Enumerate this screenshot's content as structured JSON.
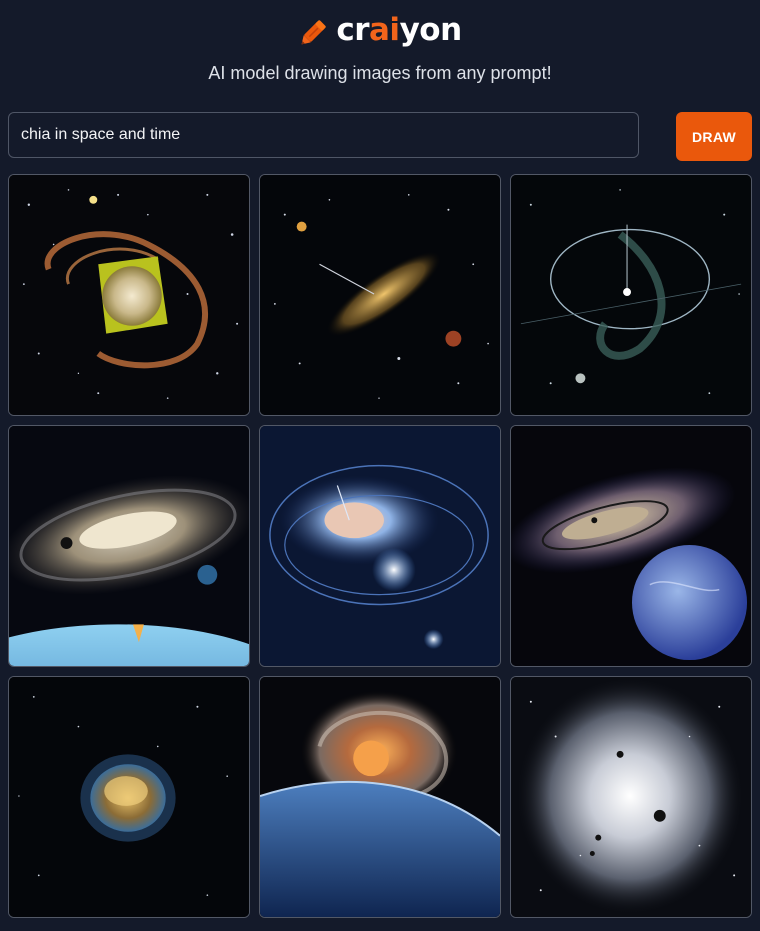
{
  "header": {
    "logo_part1": "cr",
    "logo_accent": "ai",
    "logo_part2": "yon",
    "logo_icon": "pencil-icon",
    "tagline": "AI model drawing images from any prompt!"
  },
  "prompt": {
    "value": "chia in space and time"
  },
  "draw_button": {
    "label": "DRAW"
  },
  "colors": {
    "background": "#141a2a",
    "accent": "#ea580c",
    "logo_accent": "#f2641b",
    "tile_border": "#525866"
  },
  "images": [
    {
      "name": "chia in space and time result 1"
    },
    {
      "name": "chia in space and time result 2"
    },
    {
      "name": "chia in space and time result 3"
    },
    {
      "name": "chia in space and time result 4"
    },
    {
      "name": "chia in space and time result 5"
    },
    {
      "name": "chia in space and time result 6"
    },
    {
      "name": "chia in space and time result 7"
    },
    {
      "name": "chia in space and time result 8"
    },
    {
      "name": "chia in space and time result 9"
    }
  ]
}
